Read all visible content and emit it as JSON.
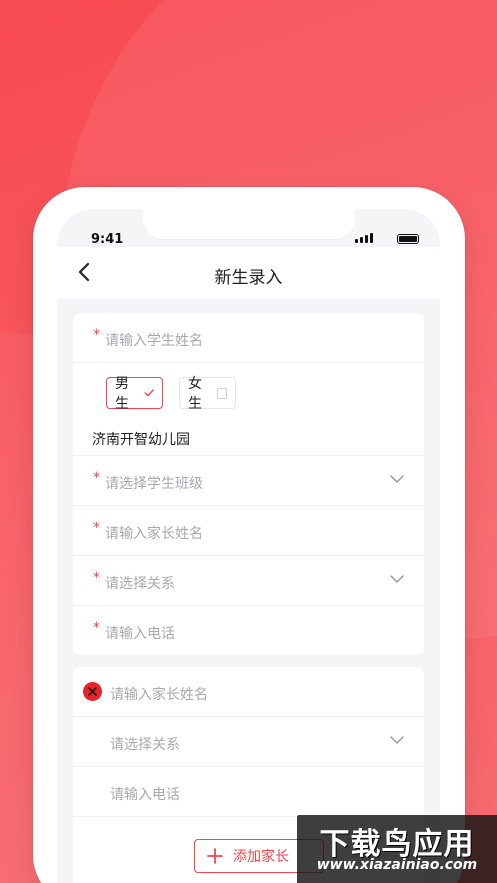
{
  "status_bar": {
    "time": "9:41"
  },
  "navbar": {
    "title": "新生录入"
  },
  "student_form": {
    "required_mark": "*",
    "student_name_placeholder": "请输入学生姓名",
    "gender": {
      "male": "男生",
      "female": "女生",
      "selected": "male"
    },
    "school": "济南开智幼儿园",
    "class_placeholder": "请选择学生班级",
    "parent_name_placeholder": "请输入家长姓名",
    "relation_placeholder": "请选择关系",
    "phone_placeholder": "请输入电话"
  },
  "extra_parent": {
    "parent_name_placeholder": "请输入家长姓名",
    "relation_placeholder": "请选择关系",
    "phone_placeholder": "请输入电话",
    "add_button_label": "添加家长"
  },
  "watermark": {
    "title": "下载鸟应用",
    "url": "www.xiazainiao.com"
  },
  "colors": {
    "accent": "#f0474d",
    "background": "#f84a52",
    "placeholder": "#a8a8b0"
  },
  "icons": [
    "back-arrow-icon",
    "signal-icon",
    "battery-icon",
    "chevron-down-icon",
    "check-icon",
    "checkbox-icon",
    "remove-circle-icon",
    "plus-icon"
  ]
}
